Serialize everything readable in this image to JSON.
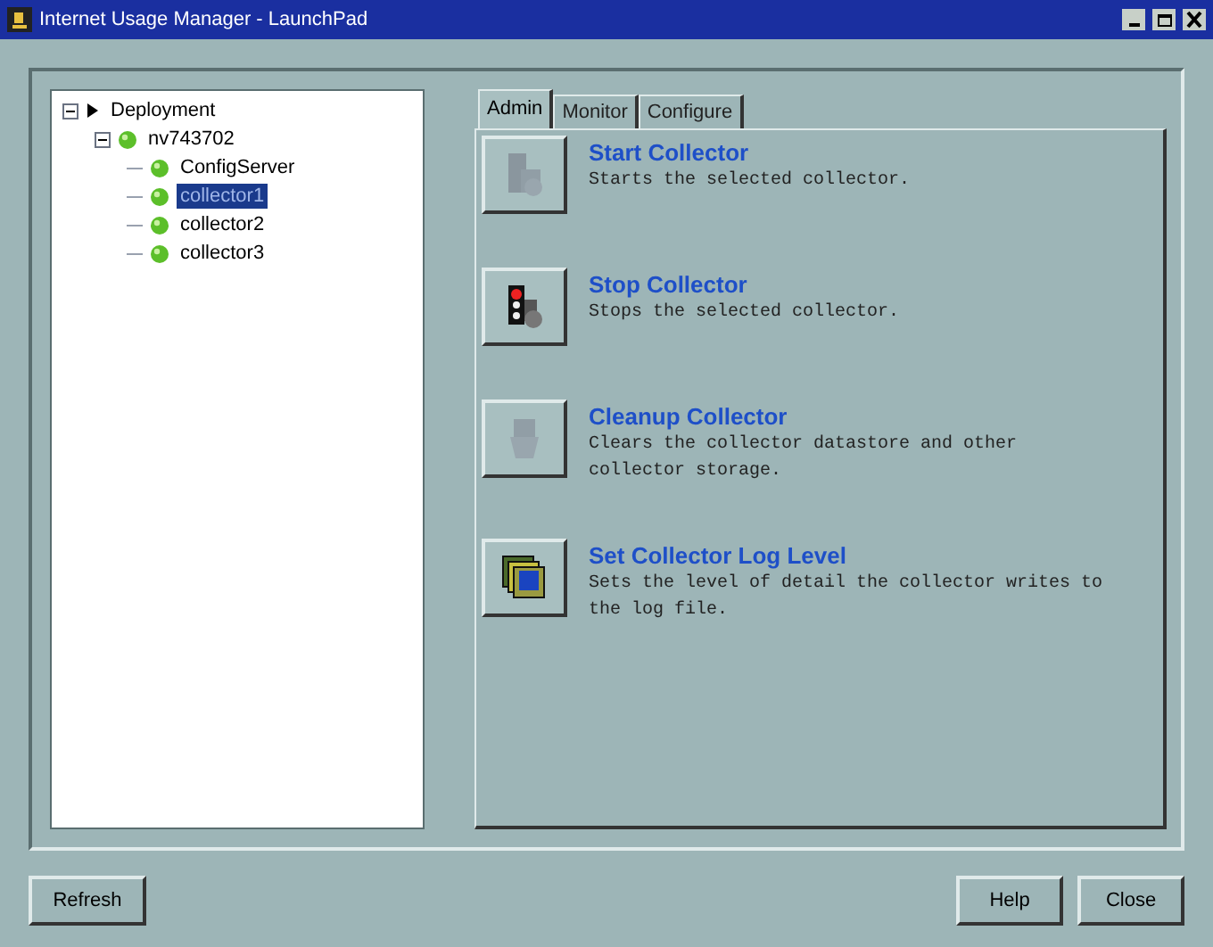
{
  "window": {
    "title": "Internet Usage Manager - LaunchPad"
  },
  "tree": [
    {
      "label": "Deployment",
      "kind": "root",
      "expanded": true,
      "selected": false,
      "children": [
        {
          "label": "nv743702",
          "kind": "status",
          "expanded": true,
          "selected": false,
          "children": [
            {
              "label": "ConfigServer",
              "kind": "status",
              "selected": false
            },
            {
              "label": "collector1",
              "kind": "status",
              "selected": true
            },
            {
              "label": "collector2",
              "kind": "status",
              "selected": false
            },
            {
              "label": "collector3",
              "kind": "status",
              "selected": false
            }
          ]
        }
      ]
    }
  ],
  "tabs": [
    {
      "label": "Admin",
      "selected": true
    },
    {
      "label": "Monitor",
      "selected": false
    },
    {
      "label": "Configure",
      "selected": false
    }
  ],
  "actions": [
    {
      "kind": "start",
      "title": "Start Collector",
      "description": "Starts the selected collector.",
      "disabled": true
    },
    {
      "kind": "stop",
      "title": "Stop Collector",
      "description": "Stops the selected collector.",
      "disabled": false
    },
    {
      "kind": "cleanup",
      "title": "Cleanup Collector",
      "description": "Clears the collector datastore and other collector storage.",
      "disabled": true
    },
    {
      "kind": "loglevel",
      "title": "Set Collector Log Level",
      "description": "Sets the level of detail the collector writes to the log file.",
      "disabled": false
    }
  ],
  "buttons_left": [
    "Refresh"
  ],
  "buttons_right": [
    "Help",
    "Close"
  ]
}
